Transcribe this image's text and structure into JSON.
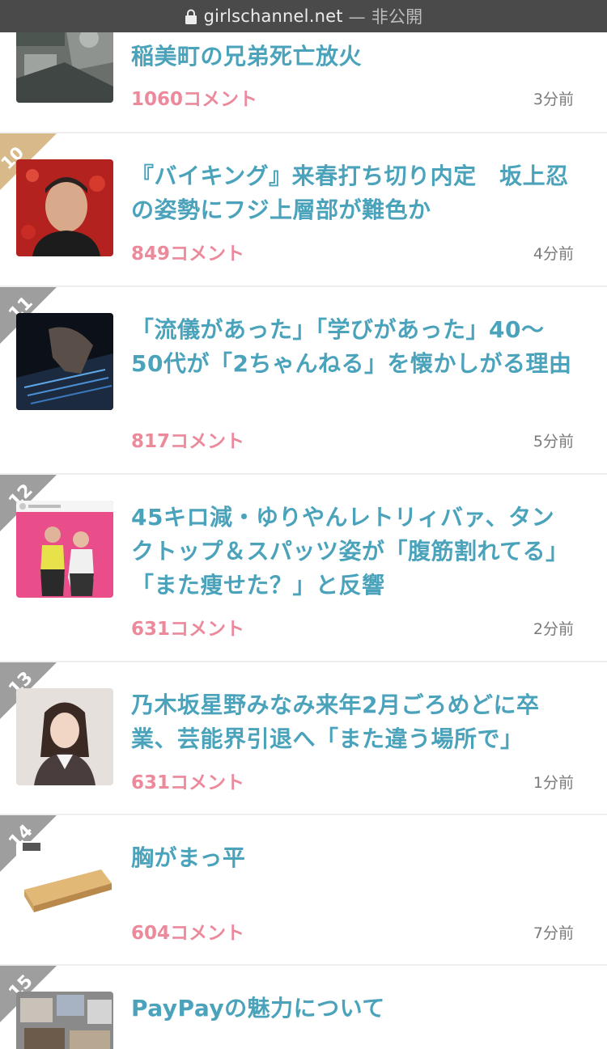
{
  "urlbar": {
    "domain": "girlschannel.net",
    "separator": "—",
    "privacy": "非公開"
  },
  "items": [
    {
      "rank": "",
      "title": "稲美町の兄弟死亡放火",
      "comments": "1060コメント",
      "time": "3分前"
    },
    {
      "rank": "10位",
      "title": "『バイキング』来春打ち切り内定　坂上忍の姿勢にフジ上層部が難色か",
      "comments": "849コメント",
      "time": "4分前"
    },
    {
      "rank": "11",
      "title": "「流儀があった」「学びがあった」40〜50代が「2ちゃんねる」を懐かしがる理由",
      "comments": "817コメント",
      "time": "5分前"
    },
    {
      "rank": "12",
      "title": "45キロ減・ゆりやんレトリィバァ、タンクトップ＆スパッツ姿が「腹筋割れてる」「また痩せた？」と反響",
      "comments": "631コメント",
      "time": "2分前"
    },
    {
      "rank": "13",
      "title": "乃木坂星野みなみ来年2月ごろめどに卒業、芸能界引退へ「また違う場所で」",
      "comments": "631コメント",
      "time": "1分前"
    },
    {
      "rank": "14",
      "title": "胸がまっ平",
      "comments": "604コメント",
      "time": "7分前"
    },
    {
      "rank": "15",
      "title": "PayPayの魅力について",
      "comments": "",
      "time": ""
    }
  ],
  "colors": {
    "title": "#4aa3bb",
    "comments": "#ec8a9c",
    "rank_top10": "#d8b98a",
    "rank_regular": "#9e9e9e"
  },
  "icons": {
    "lock": "lock-icon"
  }
}
